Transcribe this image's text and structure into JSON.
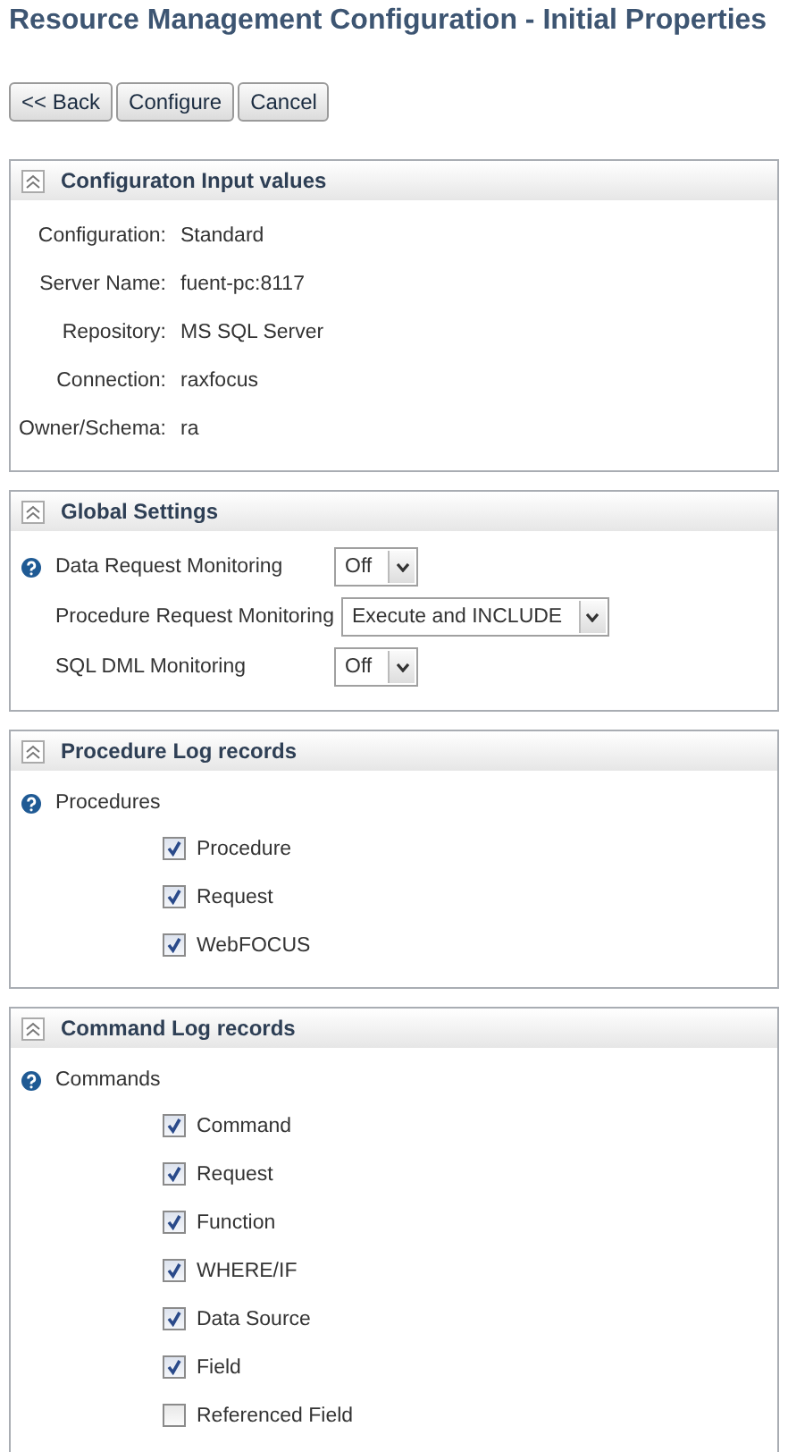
{
  "title": "Resource Management Configuration - Initial Properties",
  "buttons": [
    "<< Back",
    "Configure",
    "Cancel"
  ],
  "sections": [
    {
      "kind": "properties",
      "title": "Configuraton Input values",
      "rows": [
        {
          "label": "Configuration:",
          "value": "Standard"
        },
        {
          "label": "Server Name:",
          "value": "fuent-pc:8117"
        },
        {
          "label": "Repository:",
          "value": "MS SQL Server"
        },
        {
          "label": "Connection:",
          "value": "raxfocus"
        },
        {
          "label": "Owner/Schema:",
          "value": "ra"
        }
      ]
    },
    {
      "kind": "settings",
      "title": "Global Settings",
      "rows": [
        {
          "label": "Data Request Monitoring",
          "help": true,
          "value": "Off"
        },
        {
          "label": "Procedure Request Monitoring",
          "help": false,
          "value": "Execute and INCLUDE"
        },
        {
          "label": "SQL DML Monitoring",
          "help": false,
          "value": "Off"
        }
      ]
    },
    {
      "kind": "checklist",
      "title": "Procedure Log records",
      "group": "Procedures",
      "items": [
        {
          "label": "Procedure",
          "checked": true
        },
        {
          "label": "Request",
          "checked": true
        },
        {
          "label": "WebFOCUS",
          "checked": true
        }
      ]
    },
    {
      "kind": "checklist",
      "title": "Command Log records",
      "group": "Commands",
      "items": [
        {
          "label": "Command",
          "checked": true
        },
        {
          "label": "Request",
          "checked": true
        },
        {
          "label": "Function",
          "checked": true
        },
        {
          "label": "WHERE/IF",
          "checked": true
        },
        {
          "label": "Data Source",
          "checked": true
        },
        {
          "label": "Field",
          "checked": true
        },
        {
          "label": "Referenced Field",
          "checked": false
        }
      ]
    }
  ]
}
